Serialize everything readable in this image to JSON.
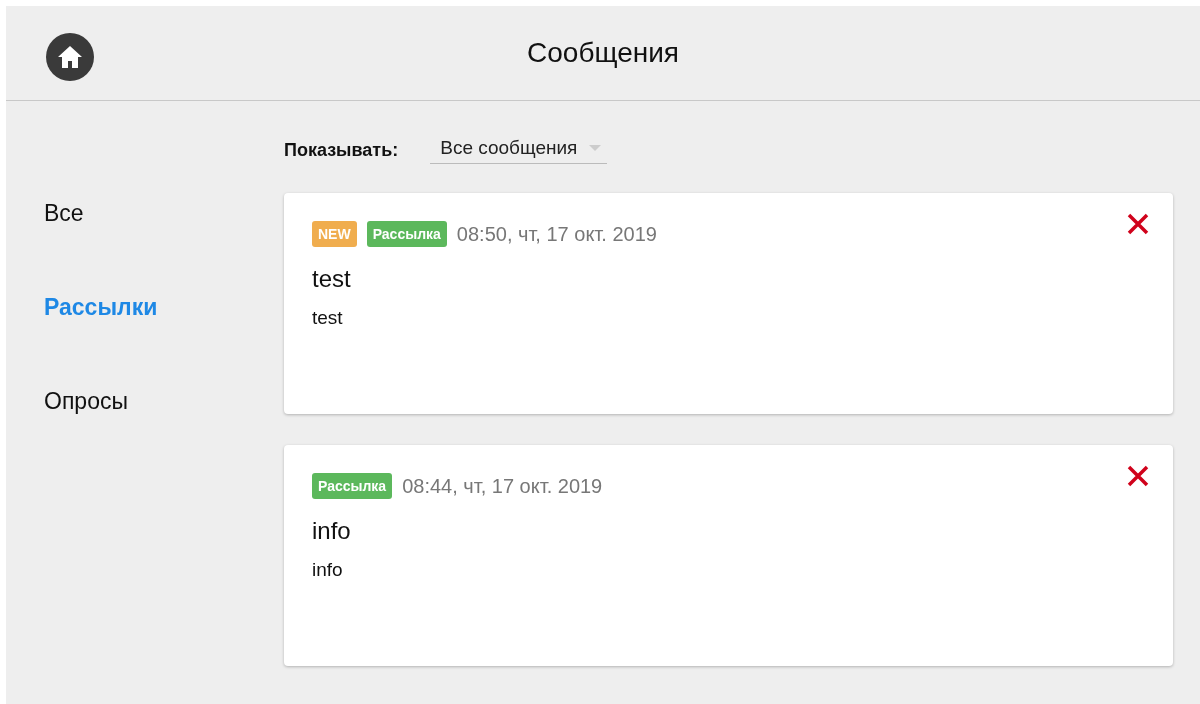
{
  "header": {
    "title": "Сообщения"
  },
  "sidebar": {
    "items": [
      {
        "label": "Все",
        "selected": false
      },
      {
        "label": "Рассылки",
        "selected": true
      },
      {
        "label": "Опросы",
        "selected": false
      }
    ]
  },
  "filter": {
    "label": "Показывать:",
    "value": "Все сообщения"
  },
  "messages": [
    {
      "tags": [
        {
          "label": "NEW",
          "color": "#f0ad4e"
        },
        {
          "label": "Рассылка",
          "color": "#5cb85c"
        }
      ],
      "time": "08:50, чт, 17 окт. 2019",
      "title": "test",
      "body": "test"
    },
    {
      "tags": [
        {
          "label": "Рассылка",
          "color": "#5cb85c"
        }
      ],
      "time": "08:44, чт, 17 окт. 2019",
      "title": "info",
      "body": "info"
    }
  ]
}
